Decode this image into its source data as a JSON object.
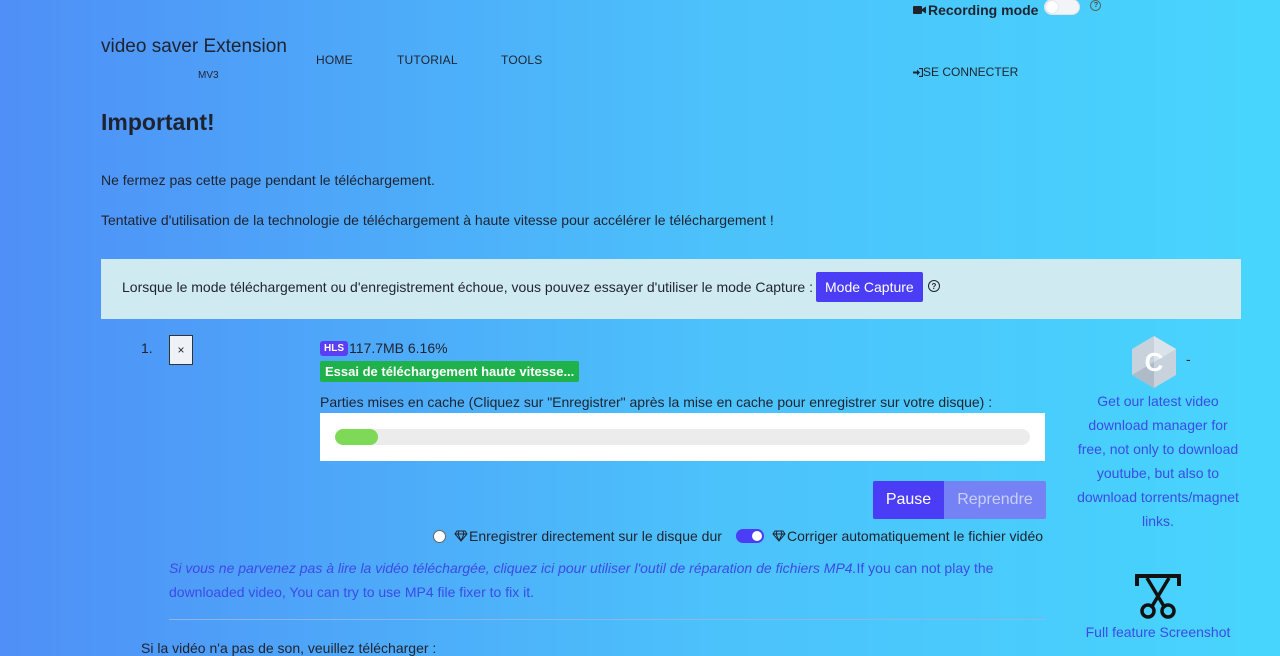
{
  "header": {
    "brand": "video saver Extension",
    "brand_sub": "MV3",
    "nav": [
      "HOME",
      "TUTORIAL",
      "TOOLS"
    ],
    "recording_label": "Recording mode",
    "recording_on": false,
    "login": "SE CONNECTER"
  },
  "main": {
    "title": "Important!",
    "notice1": "Ne fermez pas cette page pendant le téléchargement.",
    "notice2": "Tentative d'utilisation de la technologie de téléchargement à haute vitesse pour accélérer le téléchargement !",
    "alert_text": "Lorsque le mode téléchargement ou d'enregistrement échoue, vous pouvez essayer d'utiliser le mode Capture :",
    "capture_button": "Mode Capture"
  },
  "download": {
    "index": "1.",
    "close_label": "×",
    "type_badge": "HLS",
    "size_progress": "117.7MB 6.16%",
    "status_badge": "Essai de téléchargement haute vitesse...",
    "cached_label": "Parties mises en cache (Cliquez sur \"Enregistrer\" après la mise en cache pour enregistrer sur votre disque) :",
    "progress_fraction": 0.0616,
    "pause_label": "Pause",
    "resume_label": "Reprendre",
    "save_direct_label": "Enregistrer directement sur le disque dur",
    "save_direct_checked": false,
    "auto_fix_label": "Corriger automatiquement le fichier vidéo",
    "auto_fix_on": true,
    "fixer_italic": "Si vous ne parvenez pas à lire la vidéo téléchargée, cliquez ici pour utiliser l'outil de réparation de fichiers MP4.",
    "fixer_text": "If you can not play the downloaded video, You can try to use MP4 file fixer to fix it.",
    "bottom_text": "Si la vidéo n'a pas de son, veuillez télécharger :"
  },
  "sidebar": {
    "dash": "-",
    "promo1": "Get our latest video download manager for free, not only to download youtube, but also to download torrents/magnet links.",
    "promo2": "Full feature Screenshot"
  },
  "colors": {
    "accent": "#4a3df5",
    "success": "#1fb14a",
    "progress": "#7ed957",
    "link": "#3c4ae6"
  }
}
